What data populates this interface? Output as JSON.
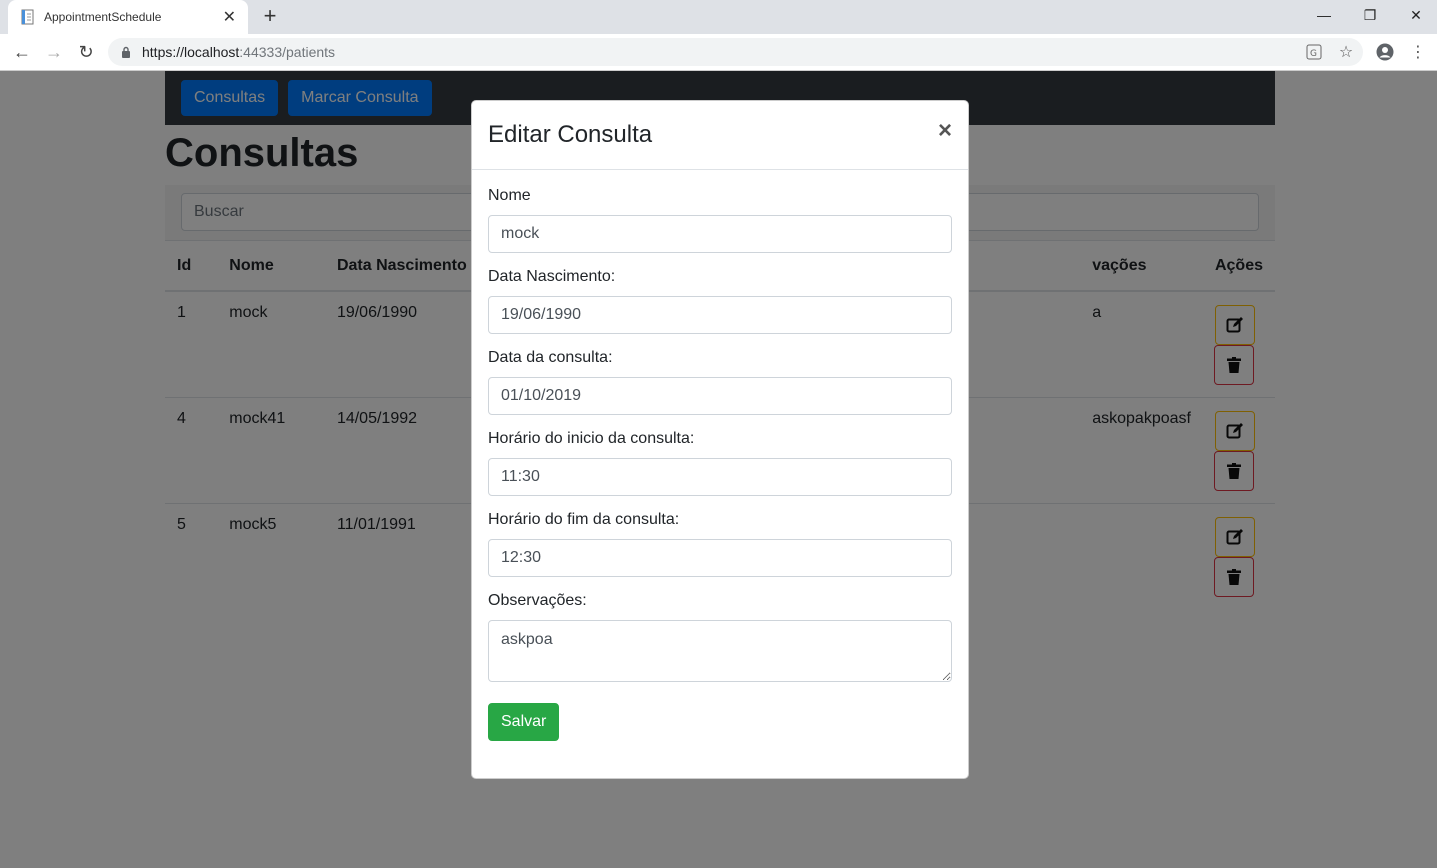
{
  "browser": {
    "tab_title": "AppointmentSchedule",
    "url_host": "https://localhost",
    "url_path": ":44333/patients"
  },
  "nav": {
    "consultas_label": "Consultas",
    "marcar_label": "Marcar Consulta"
  },
  "page": {
    "title": "Consultas",
    "search_placeholder": "Buscar"
  },
  "table": {
    "headers": [
      "Id",
      "Nome",
      "Data Nascimento",
      "vações",
      "Ações"
    ],
    "rows": [
      {
        "id": "1",
        "nome": "mock",
        "nascimento": "19/06/1990",
        "obs": "a"
      },
      {
        "id": "4",
        "nome": "mock41",
        "nascimento": "14/05/1992",
        "obs": "askopakpoasf"
      },
      {
        "id": "5",
        "nome": "mock5",
        "nascimento": "11/01/1991",
        "obs": ""
      }
    ]
  },
  "modal": {
    "title": "Editar Consulta",
    "close": "×",
    "fields": [
      {
        "label": "Nome",
        "value": "mock"
      },
      {
        "label": "Data Nascimento:",
        "value": "19/06/1990"
      },
      {
        "label": "Data da consulta:",
        "value": "01/10/2019"
      },
      {
        "label": "Horário do inicio da consulta:",
        "value": "11:30"
      },
      {
        "label": "Horário do fim da consulta:",
        "value": "12:30"
      }
    ],
    "obs_label": "Observações:",
    "obs_value": "askpoa",
    "save_label": "Salvar"
  },
  "colors": {
    "primary": "#007bff",
    "success": "#28a745",
    "warning": "#ffc107",
    "danger": "#dc3545",
    "navbar": "#343a40"
  }
}
